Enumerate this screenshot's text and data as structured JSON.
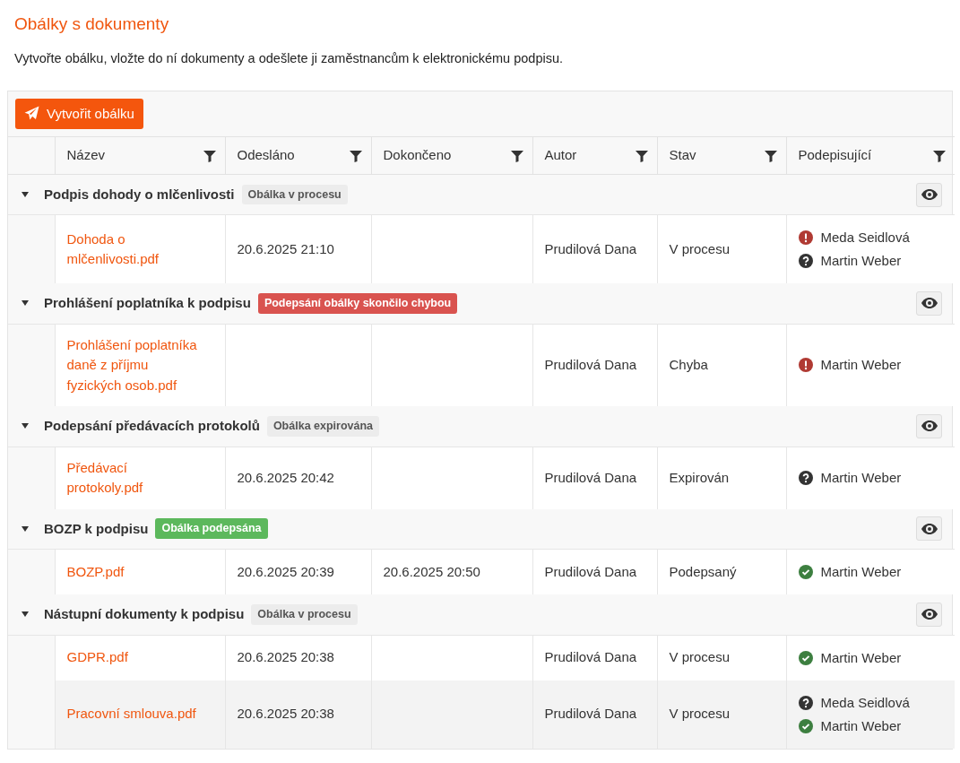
{
  "page": {
    "title": "Obálky s dokumenty",
    "description": "Vytvořte obálku, vložte do ní dokumenty a odešlete ji zaměstnancům k elektronickému podpisu."
  },
  "toolbar": {
    "create_button": "Vytvořit obálku"
  },
  "table": {
    "columns": [
      "Název",
      "Odesláno",
      "Dokončeno",
      "Autor",
      "Stav",
      "Podepisující"
    ],
    "groups": [
      {
        "title": "Podpis dohody o mlčenlivosti",
        "expanded": true,
        "badge": {
          "kind": "progress",
          "text": "Obálka v procesu"
        },
        "rows": [
          {
            "name": "Dohoda o mlčenlivosti.pdf",
            "sent": "20.6.2025 21:10",
            "completed": "",
            "author": "Prudilová Dana",
            "state": "V procesu",
            "selected": false,
            "signers": [
              {
                "kind": "error",
                "name": "Meda Seidlová"
              },
              {
                "kind": "pending",
                "name": "Martin Weber"
              }
            ]
          }
        ]
      },
      {
        "title": "Prohlášení poplatníka k podpisu",
        "expanded": true,
        "badge": {
          "kind": "error",
          "text": "Podepsání obálky skončilo chybou"
        },
        "rows": [
          {
            "name": "Prohlášení poplatníka daně z příjmu fyzických osob.pdf",
            "sent": "",
            "completed": "",
            "author": "Prudilová Dana",
            "state": "Chyba",
            "selected": false,
            "signers": [
              {
                "kind": "error",
                "name": "Martin Weber"
              }
            ]
          }
        ]
      },
      {
        "title": "Podepsání předávacích protokolů",
        "expanded": true,
        "badge": {
          "kind": "expired",
          "text": "Obálka expirována"
        },
        "rows": [
          {
            "name": "Předávací protokoly.pdf",
            "sent": "20.6.2025 20:42",
            "completed": "",
            "author": "Prudilová Dana",
            "state": "Expirován",
            "selected": false,
            "signers": [
              {
                "kind": "pending",
                "name": "Martin Weber"
              }
            ]
          }
        ]
      },
      {
        "title": "BOZP k podpisu",
        "expanded": true,
        "badge": {
          "kind": "signed",
          "text": "Obálka podepsána"
        },
        "rows": [
          {
            "name": "BOZP.pdf",
            "sent": "20.6.2025 20:39",
            "completed": "20.6.2025 20:50",
            "author": "Prudilová Dana",
            "state": "Podepsaný",
            "selected": false,
            "signers": [
              {
                "kind": "signed",
                "name": "Martin Weber"
              }
            ]
          }
        ]
      },
      {
        "title": "Nástupní dokumenty k podpisu",
        "expanded": true,
        "badge": {
          "kind": "progress",
          "text": "Obálka v procesu"
        },
        "rows": [
          {
            "name": "GDPR.pdf",
            "sent": "20.6.2025 20:38",
            "completed": "",
            "author": "Prudilová Dana",
            "state": "V procesu",
            "selected": false,
            "signers": [
              {
                "kind": "signed",
                "name": "Martin Weber"
              }
            ]
          },
          {
            "name": "Pracovní smlouva.pdf",
            "sent": "20.6.2025 20:38",
            "completed": "",
            "author": "Prudilová Dana",
            "state": "V procesu",
            "selected": true,
            "signers": [
              {
                "kind": "pending",
                "name": "Meda Seidlová"
              },
              {
                "kind": "signed",
                "name": "Martin Weber"
              }
            ]
          }
        ]
      }
    ]
  }
}
